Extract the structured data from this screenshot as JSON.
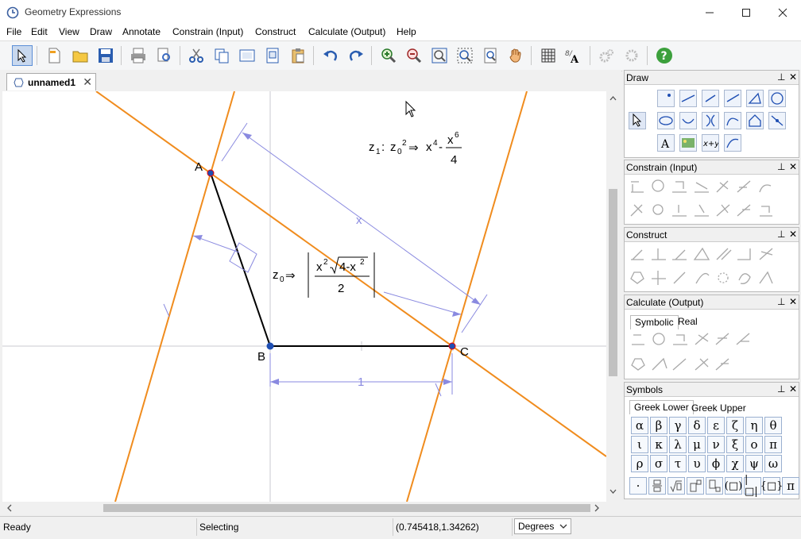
{
  "window": {
    "title": "Geometry Expressions"
  },
  "menu": [
    "File",
    "Edit",
    "View",
    "Draw",
    "Annotate",
    "Constrain (Input)",
    "Construct",
    "Calculate (Output)",
    "Help"
  ],
  "toolbar": {
    "icons": [
      "select-arrow-icon",
      "new-file-icon",
      "open-folder-icon",
      "save-icon",
      "print-icon",
      "print-preview-icon",
      "cut-icon",
      "copy-icon",
      "copy-as-icon",
      "copy-special-icon",
      "paste-icon",
      "undo-icon",
      "redo-icon",
      "zoom-in-icon",
      "zoom-out-icon",
      "zoom-fit-icon",
      "zoom-window-icon",
      "zoom-page-icon",
      "pan-hand-icon",
      "grid-icon",
      "text-format-icon",
      "settings-gear-icon",
      "settings-gear-2-icon",
      "help-icon"
    ]
  },
  "document": {
    "tab_label": "unnamed1",
    "points": {
      "A": "A",
      "B": "B",
      "C": "C"
    },
    "labels": {
      "x": "x",
      "one": "1"
    },
    "expr_z1": {
      "name": "z",
      "sub1": "1",
      "colon": ":",
      "z0": "z",
      "sub0": "0",
      "exp2": "2",
      "arrow": "⇒",
      "xbase": "x",
      "exp4": "4",
      "minus": "-",
      "numx": "x",
      "exp6": "6",
      "den": "4"
    },
    "expr_z0": {
      "name": "z",
      "sub0": "0",
      "arrow": "⇒",
      "x": "x",
      "exp2": "2",
      "dot": "·",
      "root": "4-x",
      "rootexp": "2",
      "den": "2"
    }
  },
  "panels": {
    "draw": {
      "title": "Draw"
    },
    "constrain": {
      "title": "Constrain (Input)"
    },
    "construct": {
      "title": "Construct"
    },
    "calculate": {
      "title": "Calculate (Output)",
      "tabs": [
        "Symbolic",
        "Real"
      ]
    },
    "symbols": {
      "title": "Symbols",
      "tabs": [
        "Greek Lower",
        "Greek Upper"
      ],
      "rows": [
        [
          "α",
          "β",
          "γ",
          "δ",
          "ε",
          "ζ",
          "η",
          "θ"
        ],
        [
          "ι",
          "κ",
          "λ",
          "μ",
          "ν",
          "ξ",
          "ο",
          "π"
        ],
        [
          "ρ",
          "σ",
          "τ",
          "υ",
          "ϕ",
          "χ",
          "ψ",
          "ω"
        ]
      ],
      "extra_last": "π"
    },
    "pin": "⊥",
    "close": "✕"
  },
  "status": {
    "ready": "Ready",
    "mode": "Selecting",
    "coords": "(0.745418,1.34262)",
    "angle_unit": "Degrees"
  },
  "colors": {
    "orange": "#f08c1e",
    "dim": "#8a8ae0",
    "accent": "#1f4fb3"
  }
}
